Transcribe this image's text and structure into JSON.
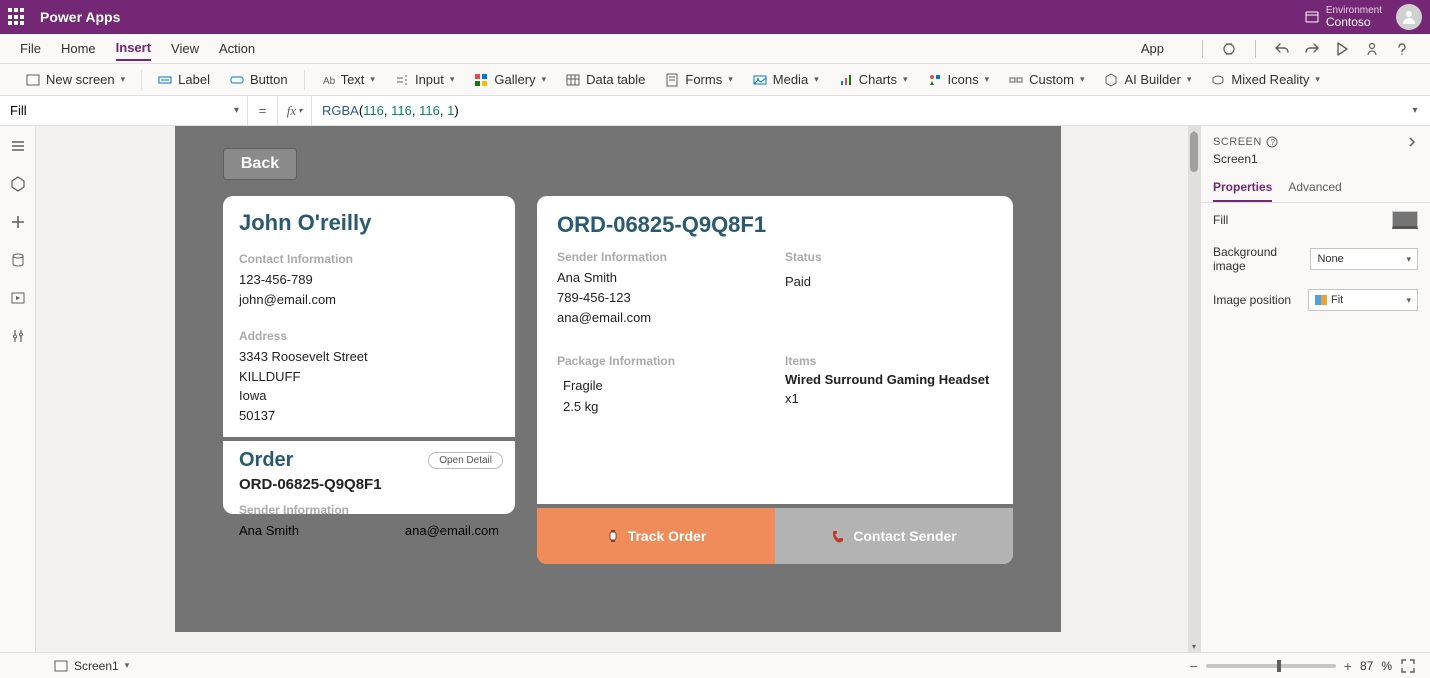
{
  "topbar": {
    "product": "Power Apps",
    "env_label": "Environment",
    "env_name": "Contoso"
  },
  "menu": {
    "items": [
      "File",
      "Home",
      "Insert",
      "View",
      "Action"
    ],
    "active_index": 2,
    "app_label": "App"
  },
  "ribbon": {
    "new_screen": "New screen",
    "label": "Label",
    "button": "Button",
    "text": "Text",
    "input": "Input",
    "gallery": "Gallery",
    "data_table": "Data table",
    "forms": "Forms",
    "media": "Media",
    "charts": "Charts",
    "icons": "Icons",
    "custom": "Custom",
    "ai_builder": "AI Builder",
    "mixed_reality": "Mixed Reality"
  },
  "formula": {
    "property": "Fill",
    "fn": "RGBA",
    "args": [
      "116",
      "116",
      "116",
      "1"
    ]
  },
  "canvas": {
    "back": "Back",
    "customer": {
      "name": "John O'reilly",
      "contact_label": "Contact Information",
      "phone": "123-456-789",
      "email": "john@email.com",
      "address_label": "Address",
      "street": "3343  Roosevelt Street",
      "city": "KILLDUFF",
      "state": "Iowa",
      "zip": "50137"
    },
    "order_summary": {
      "title": "Order",
      "open_detail": "Open Detail",
      "code": "ORD-06825-Q9Q8F1",
      "sender_label": "Sender Information",
      "sender_name": "Ana Smith",
      "sender_email": "ana@email.com"
    },
    "order_detail": {
      "code": "ORD-06825-Q9Q8F1",
      "sender_label": "Sender Information",
      "sender_name": "Ana Smith",
      "sender_phone": "789-456-123",
      "sender_email": "ana@email.com",
      "status_label": "Status",
      "status_value": "Paid",
      "package_label": "Package Information",
      "fragile": "Fragile",
      "weight": "2.5 kg",
      "items_label": "Items",
      "item_name": "Wired Surround Gaming Headset",
      "item_qty": "x1",
      "track": "Track Order",
      "contact": "Contact Sender"
    }
  },
  "proppanel": {
    "header": "SCREEN",
    "name": "Screen1",
    "tabs": [
      "Properties",
      "Advanced"
    ],
    "fill_label": "Fill",
    "bg_label": "Background image",
    "bg_value": "None",
    "imgpos_label": "Image position",
    "imgpos_value": "Fit"
  },
  "statusbar": {
    "screen": "Screen1",
    "zoom_value": "87",
    "zoom_pct": "%"
  }
}
